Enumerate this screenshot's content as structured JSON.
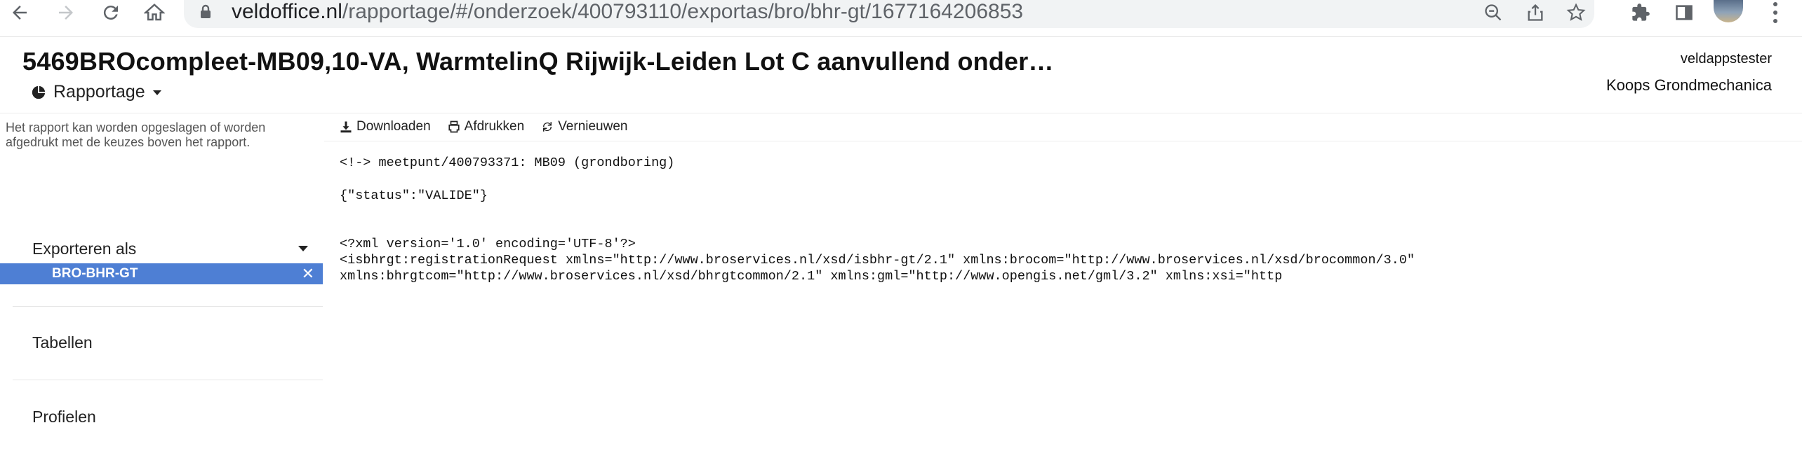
{
  "browser": {
    "url_host": "veldoffice.nl",
    "url_path": "/rapportage/#/onderzoek/400793110/exportas/bro/bhr-gt/1677164206853"
  },
  "header": {
    "title": "5469BROcompleet-MB09,10-VA, WarmtelinQ Rijwijk-Leiden Lot C aanvullend onder…",
    "menu_label": "Rapportage",
    "user": "veldappstester",
    "organization": "Koops Grondmechanica"
  },
  "sidebar": {
    "hint": "Het rapport kan worden opgeslagen of worden afgedrukt met de keuzes boven het rapport.",
    "export_title": "Exporteren als",
    "export_selected": "BRO-BHR-GT",
    "sections": [
      "Tabellen",
      "Profielen"
    ]
  },
  "toolbar": {
    "download": "Downloaden",
    "print": "Afdrukken",
    "refresh": "Vernieuwen"
  },
  "report": {
    "line1": "<!-> meetpunt/400793371: MB09 (grondboring)",
    "line2": "{\"status\":\"VALIDE\"}",
    "line3": "<?xml version='1.0' encoding='UTF-8'?>",
    "line4": "<isbhrgt:registrationRequest xmlns=\"http://www.broservices.nl/xsd/isbhr-gt/2.1\" xmlns:brocom=\"http://www.broservices.nl/xsd/brocommon/3.0\"",
    "line5": "xmlns:bhrgtcom=\"http://www.broservices.nl/xsd/bhrgtcommon/2.1\" xmlns:gml=\"http://www.opengis.net/gml/3.2\" xmlns:xsi=\"http"
  }
}
